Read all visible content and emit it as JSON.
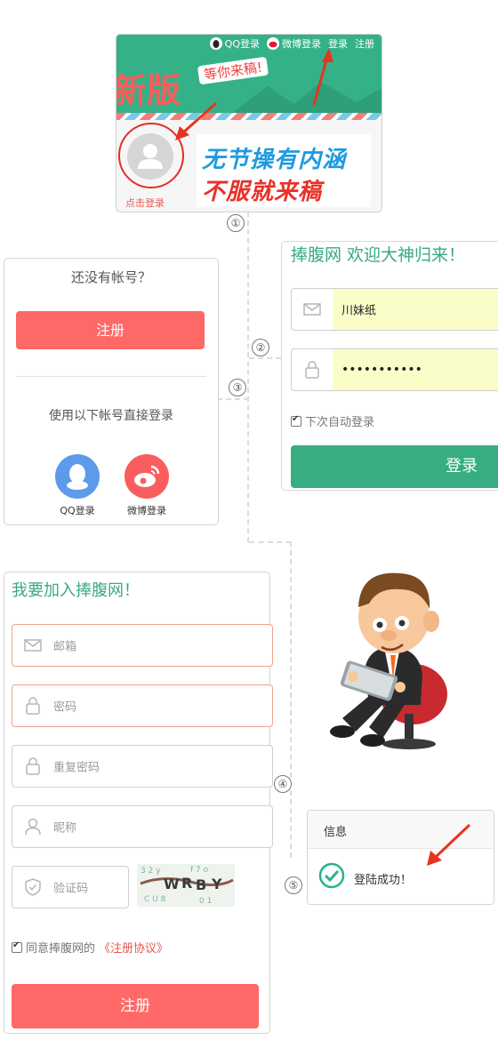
{
  "header": {
    "nav": {
      "qq_login": "QQ登录",
      "weibo_login": "微博登录",
      "login": "登录",
      "register": "注册"
    },
    "banner_word": "新版",
    "slogan": "等你来稿!",
    "avatar_caption": "点击登录",
    "promo_line1": "无节操有内涵",
    "promo_line2": "不服就来稿"
  },
  "steps": [
    "①",
    "②",
    "③",
    "④",
    "⑤"
  ],
  "login_panel": {
    "title": "捧腹网 欢迎大神归来！",
    "username_value": "川妹纸",
    "password_value": "•••••••••••",
    "remember_label": "下次自动登录",
    "login_button": "登录"
  },
  "no_account_panel": {
    "question": "还没有帐号？",
    "register_button": "注册",
    "use_accounts": "使用以下帐号直接登录",
    "qq_label": "QQ登录",
    "weibo_label": "微博登录"
  },
  "register_panel": {
    "title": "我要加入捧腹网！",
    "email_placeholder": "邮箱",
    "password_placeholder": "密码",
    "repeat_password_placeholder": "重复密码",
    "nickname_placeholder": "昵称",
    "captcha_placeholder": "验证码",
    "agree_prefix": "同意捧腹网的",
    "agree_link": "《注册协议》",
    "register_button": "注册"
  },
  "info_dialog": {
    "title": "信息",
    "message": "登陆成功！"
  },
  "colors": {
    "green": "#37ad82",
    "coral": "#fe6866",
    "autofill": "#fbfdc9",
    "annotation_red": "#e8331f"
  }
}
